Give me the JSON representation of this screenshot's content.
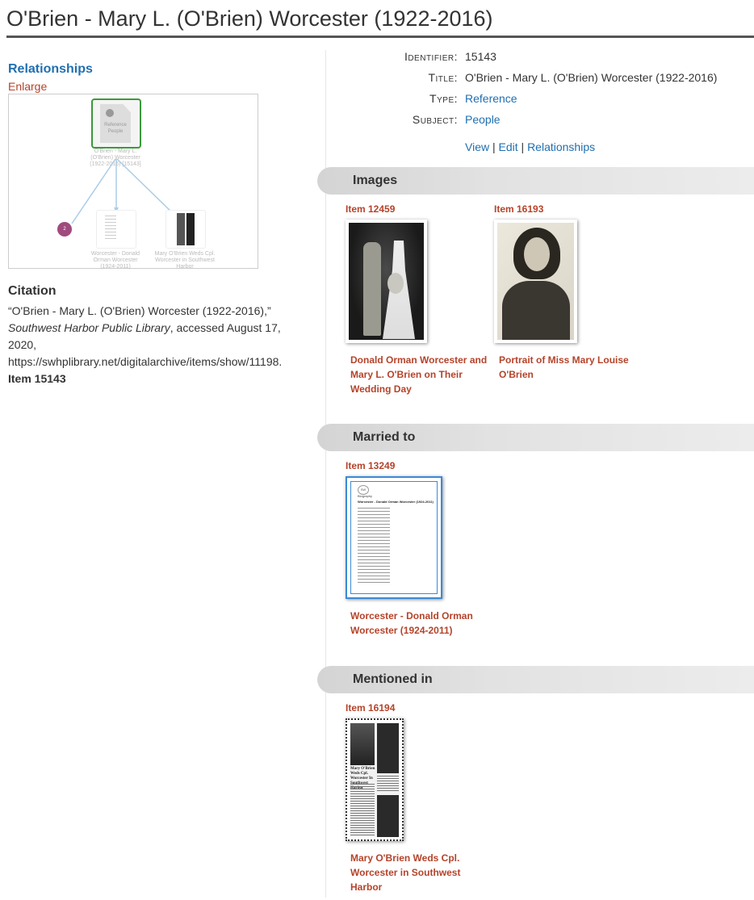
{
  "page": {
    "title": "O'Brien - Mary L. (O'Brien) Worcester (1922-2016)"
  },
  "relationships": {
    "heading": "Relationships",
    "enlarge": "Enlarge",
    "graph": {
      "center_label": "Reference\nPeople",
      "center_caption": "O'Brien - Mary L.\n(O'Brien) Worcester\n(1922-2016) [15143]",
      "count_badge": "2",
      "node_left_caption": "Worcester - Donald\nOrman Worcester\n(1924-2011)",
      "node_right_caption": "Mary O'Brien Weds Cpl.\nWorcester in Southwest\nHarbor"
    }
  },
  "citation": {
    "heading": "Citation",
    "text_before": "“O'Brien - Mary L. (O'Brien) Worcester (1922-2016),” ",
    "source": "Southwest Harbor Public Library",
    "text_after": ", accessed August 17, 2020, https://swhplibrary.net/digitalarchive/items/show/11198. ",
    "item_ref": "Item 15143"
  },
  "metadata": [
    {
      "label": "Identifier:",
      "value": "15143",
      "link": false
    },
    {
      "label": "Title:",
      "value": "O'Brien - Mary L. (O'Brien) Worcester (1922-2016)",
      "link": false
    },
    {
      "label": "Type:",
      "value": "Reference",
      "link": true
    },
    {
      "label": "Subject:",
      "value": "People",
      "link": true
    }
  ],
  "actions": {
    "view": "View",
    "edit": "Edit",
    "relationships": "Relationships",
    "separator": " | "
  },
  "sections": {
    "images": {
      "heading": "Images",
      "items": [
        {
          "id": "Item 12459",
          "title": "Donald Orman Worcester and Mary L. O'Brien on Their Wedding Day"
        },
        {
          "id": "Item 16193",
          "title": "Portrait of Miss Mary Louise O'Brien"
        }
      ]
    },
    "married_to": {
      "heading": "Married to",
      "items": [
        {
          "id": "Item 13249",
          "title": "Worcester - Donald Orman Worcester (1924-2011)",
          "doc_logo": "SW",
          "doc_kind": "Biography",
          "doc_title": "Worcester - Donald Orman Worcester (1924-2011)"
        }
      ]
    },
    "mentioned_in": {
      "heading": "Mentioned in",
      "items": [
        {
          "id": "Item 16194",
          "title": "Mary O'Brien Weds Cpl. Worcester in Southwest Harbor",
          "clip_headline": "Mary O'Brien Weds Cpl. Worcester In Southwest Harbor"
        }
      ]
    }
  },
  "colors": {
    "link": "#1f6fb0",
    "item_accent": "#b5432a",
    "graph_green": "#3a9a3a",
    "badge": "#a04a7e"
  }
}
